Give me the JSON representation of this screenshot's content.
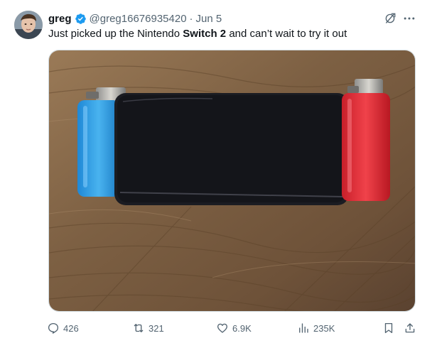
{
  "tweet": {
    "display_name": "greg",
    "handle": "@greg16676935420",
    "separator": "·",
    "date": "Jun 5",
    "text_before": "Just picked up the Nintendo ",
    "text_bold": "Switch 2",
    "text_after": " and can’t wait to try it out"
  },
  "stats": {
    "replies": "426",
    "reposts": "321",
    "likes": "6.9K",
    "views": "235K"
  },
  "colors": {
    "verified": "#1d9bf0",
    "secondary_text": "#536471",
    "lighter_left": "#2f9ee0",
    "lighter_right": "#e9303a",
    "device": "#14151a"
  },
  "icons": [
    "verified-badge-icon",
    "grok-icon",
    "more-icon",
    "reply-icon",
    "repost-icon",
    "like-icon",
    "views-icon",
    "bookmark-icon",
    "share-icon"
  ]
}
